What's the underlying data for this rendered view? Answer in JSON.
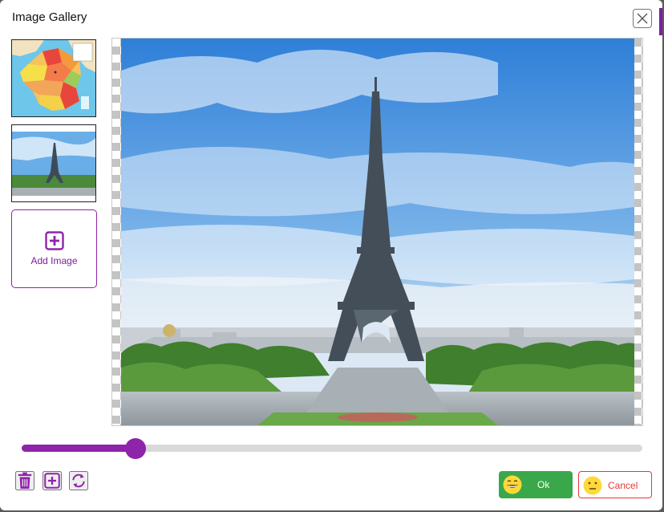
{
  "dialog": {
    "title": "Image Gallery"
  },
  "sidebar": {
    "thumbnails": [
      {
        "icon": "map-of-france-thumbnail"
      },
      {
        "icon": "eiffel-tower-thumbnail"
      }
    ],
    "add_image_label": "Add Image"
  },
  "slider": {
    "value_fraction": 0.184
  },
  "toolbar": {
    "icons": [
      "trash-icon",
      "add-icon",
      "refresh-icon"
    ]
  },
  "actions": {
    "ok_label": "Ok",
    "cancel_label": "Cancel"
  },
  "colors": {
    "accent": "#8e24aa",
    "ok": "#3aa84a",
    "cancel": "#e53935"
  }
}
